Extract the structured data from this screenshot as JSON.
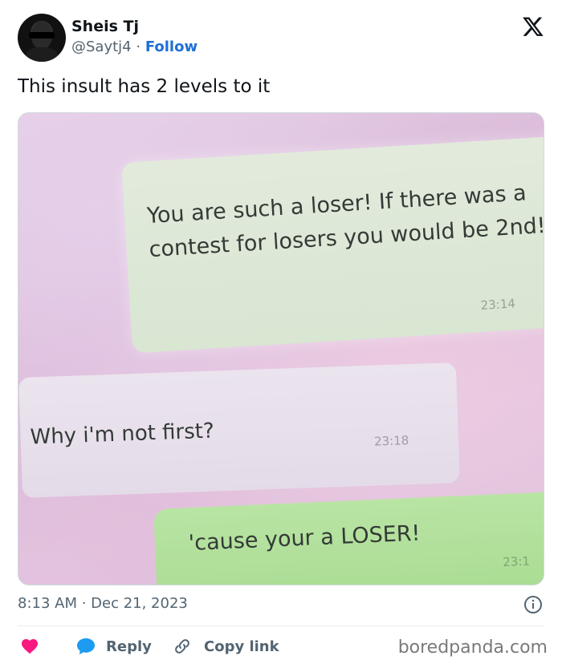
{
  "user": {
    "display_name": "Sheis Tj",
    "handle": "@Saytj4",
    "separator": "·",
    "follow_label": "Follow"
  },
  "tweet": {
    "text": "This insult has 2 levels to it",
    "timestamp": "8:13 AM · Dec 21, 2023"
  },
  "media": {
    "messages": [
      {
        "text": "You are such a loser! If there was a contest for losers you would be 2nd!",
        "time": "23:14"
      },
      {
        "text": "Why i'm not first?",
        "time": "23:18"
      },
      {
        "text": "'cause your a LOSER!",
        "time": "23:1"
      }
    ]
  },
  "actions": {
    "like_icon": "heart-icon",
    "reply_label": "Reply",
    "copy_label": "Copy link"
  },
  "watermark": "boredpanda.com",
  "colors": {
    "follow": "#1d6fd6",
    "like": "#f91880",
    "reply": "#1d9bf0",
    "muted": "#536471"
  }
}
